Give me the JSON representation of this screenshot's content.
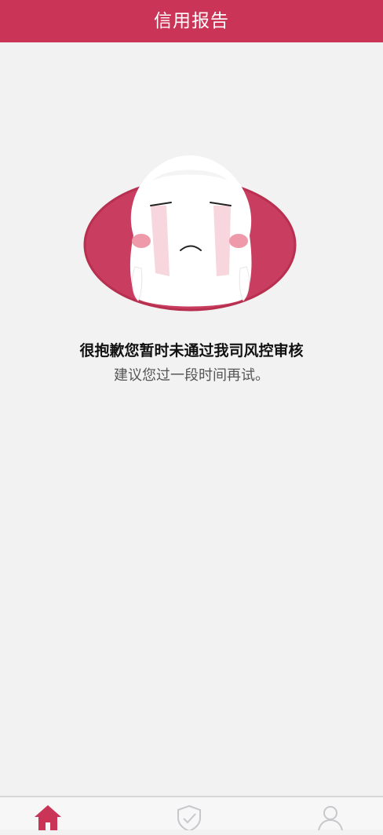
{
  "header": {
    "title": "信用报告"
  },
  "message": {
    "title": "很抱歉您暂时未通过我司风控审核",
    "subtitle": "建议您过一段时间再试。"
  },
  "tabbar": {
    "tabs": [
      {
        "icon": "home-icon",
        "active": true
      },
      {
        "icon": "shield-check-icon",
        "active": false
      },
      {
        "icon": "user-icon",
        "active": false
      }
    ]
  },
  "colors": {
    "brand": "#c93457",
    "background": "#f2f2f3",
    "inactive_icon": "#c8c8cc"
  }
}
